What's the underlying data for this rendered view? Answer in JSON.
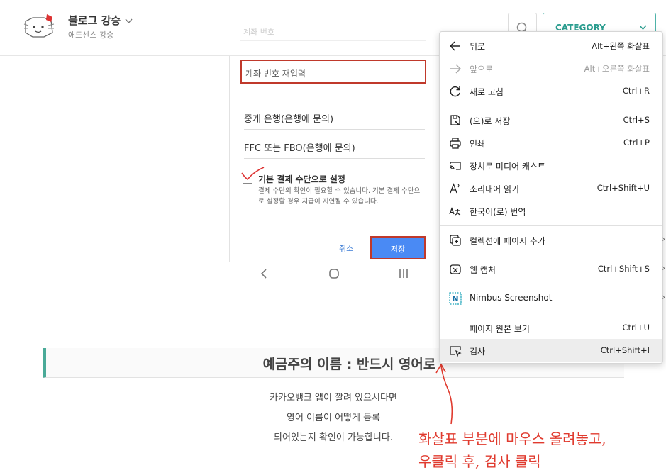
{
  "header": {
    "blog_title": "블로그 강승",
    "blog_subtitle": "애드센스 강승",
    "category_label": "CATEGORY"
  },
  "phone": {
    "faded_input": "계좌 번호",
    "reenter_field": "계좌 번호 재입력",
    "fields": [
      "중개 은행(은행에 문의)",
      "FFC 또는 FBO(은행에 문의)"
    ],
    "checkbox_label": "기본 결제 수단으로 설정",
    "checkbox_desc": "결제 수단의 확인이 필요할 수 있습니다. 기본 결제 수단으로 설정할 경우 지급이 지연될 수 있습니다.",
    "cancel_label": "취소",
    "save_label": "저장"
  },
  "article": {
    "heading": "예금주의 이름 : 반드시 영어로",
    "paragraphs": [
      "카카오뱅크 앱이 깔려 있으시다면",
      "영어 이름이 어떻게 등록",
      "되어있는지 확인이 가능합니다."
    ]
  },
  "context_menu": {
    "items": [
      {
        "label": "뒤로",
        "shortcut": "Alt+왼쪽 화살표",
        "icon": "back-arrow-icon",
        "disabled": false
      },
      {
        "label": "앞으로",
        "shortcut": "Alt+오른쪽 화살표",
        "icon": "forward-arrow-icon",
        "disabled": true
      },
      {
        "label": "새로 고침",
        "shortcut": "Ctrl+R",
        "icon": "refresh-icon",
        "disabled": false
      },
      {
        "label": "(으)로 저장",
        "shortcut": "Ctrl+S",
        "icon": "save-as-icon",
        "disabled": false
      },
      {
        "label": "인쇄",
        "shortcut": "Ctrl+P",
        "icon": "print-icon",
        "disabled": false
      },
      {
        "label": "장치로 미디어 캐스트",
        "shortcut": "",
        "icon": "cast-icon",
        "disabled": false
      },
      {
        "label": "소리내어 읽기",
        "shortcut": "Ctrl+Shift+U",
        "icon": "read-aloud-icon",
        "disabled": false
      },
      {
        "label": "한국어(로) 번역",
        "shortcut": "",
        "icon": "translate-icon",
        "disabled": false
      },
      {
        "label": "컬렉션에 페이지 추가",
        "shortcut": "",
        "icon": "collections-icon",
        "disabled": false
      },
      {
        "label": "웹 캡처",
        "shortcut": "Ctrl+Shift+S",
        "icon": "web-capture-icon",
        "disabled": false
      },
      {
        "label": "Nimbus Screenshot",
        "shortcut": "",
        "icon": "nimbus-icon",
        "disabled": false
      },
      {
        "label": "페이지 원본 보기",
        "shortcut": "Ctrl+U",
        "icon": "",
        "disabled": false
      },
      {
        "label": "검사",
        "shortcut": "Ctrl+Shift+I",
        "icon": "inspect-icon",
        "disabled": false
      }
    ]
  },
  "annotation": {
    "line1": "화살표 부분에 마우스 올려놓고,",
    "line2": "우클릭 후, 검사 클릭"
  },
  "colors": {
    "accent_teal": "#4aaa98",
    "annotation_red": "#e03a2e",
    "save_blue": "#4a8af4"
  }
}
